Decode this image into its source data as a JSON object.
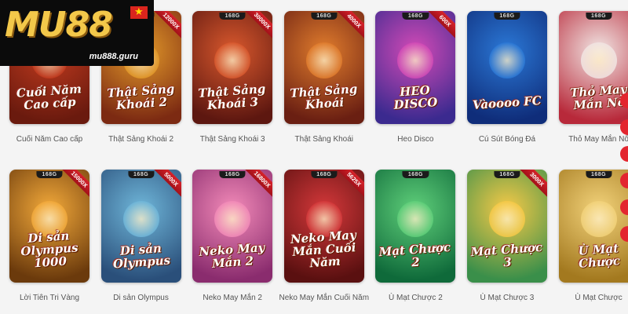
{
  "logo": {
    "text": "MU88",
    "domain": "mu888.guru"
  },
  "badge_text": "168G",
  "rows": [
    [
      {
        "label": "Cuối Năm Cao cấp",
        "art": "Cuối Năm Cao cấp",
        "ribbon": "",
        "colors": [
          "#c23b1f",
          "#6a1a0e"
        ]
      },
      {
        "label": "Thật Sảng Khoái 2",
        "art": "Thật Sảng Khoái 2",
        "ribbon": "12000X",
        "colors": [
          "#e39a2a",
          "#7c2a12"
        ]
      },
      {
        "label": "Thật Sảng Khoái 3",
        "art": "Thật Sảng Khoái 3",
        "ribbon": "30000X",
        "colors": [
          "#d8582d",
          "#5d1710"
        ]
      },
      {
        "label": "Thật Sảng Khoái",
        "art": "Thật Sảng Khoái",
        "ribbon": "4000X",
        "colors": [
          "#e07c2d",
          "#6a1f12"
        ]
      },
      {
        "label": "Heo Disco",
        "art": "HEO DISCO",
        "ribbon": "600X",
        "colors": [
          "#d24ab6",
          "#3b2a8f"
        ]
      },
      {
        "label": "Cú Sút Bóng Đá",
        "art": "Vàoooo FC",
        "ribbon": "",
        "colors": [
          "#2b78d6",
          "#0f2d7a"
        ]
      },
      {
        "label": "Thỏ May Mắn Nổ",
        "art": "Thỏ May Mắn Nổ",
        "ribbon": "",
        "colors": [
          "#f1e5e3",
          "#b8293a"
        ]
      }
    ],
    [
      {
        "label": "Lời Tiên Tri Vàng",
        "art": "Di sản Olympus 1000",
        "ribbon": "15000X",
        "colors": [
          "#f2a93a",
          "#6b3a0c"
        ]
      },
      {
        "label": "Di sản Olympus",
        "art": "Di sản Olympus",
        "ribbon": "5000X",
        "colors": [
          "#6fb6d9",
          "#2a4f7a"
        ]
      },
      {
        "label": "Neko May Mắn 2",
        "art": "Neko May Mắn 2",
        "ribbon": "16800X",
        "colors": [
          "#f28ab8",
          "#8a2c6e"
        ]
      },
      {
        "label": "Neko May Mắn Cuối Năm",
        "art": "Neko May Mắn Cuối Năm",
        "ribbon": "5625X",
        "colors": [
          "#d4383a",
          "#5a1010"
        ]
      },
      {
        "label": "Ù Mạt Chược 2",
        "art": "Mạt Chược 2",
        "ribbon": "",
        "colors": [
          "#5fcf7a",
          "#0f6a3a"
        ]
      },
      {
        "label": "Ù Mạt Chược 3",
        "art": "Mạt Chược 3",
        "ribbon": "3000X",
        "colors": [
          "#f6c947",
          "#3a8f4a"
        ]
      },
      {
        "label": "Ù Mạt Chược",
        "art": "Ù Mạt Chược",
        "ribbon": "",
        "colors": [
          "#f2d27a",
          "#a3791f"
        ]
      }
    ]
  ]
}
